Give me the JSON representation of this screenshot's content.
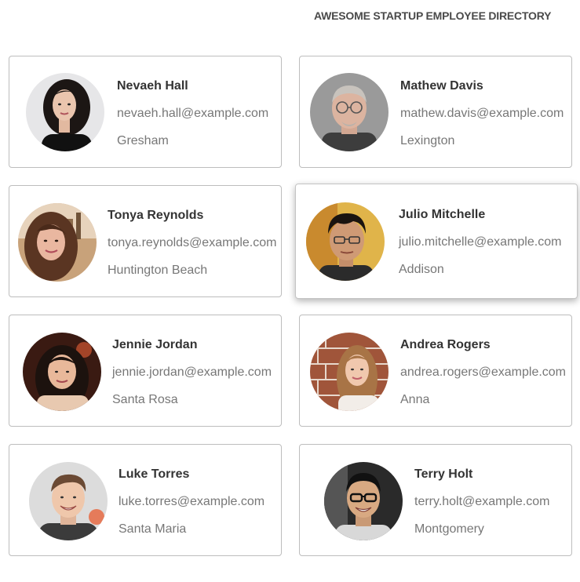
{
  "header": {
    "title": "AWESOME STARTUP EMPLOYEE DIRECTORY"
  },
  "employees": [
    {
      "name": "Nevaeh Hall",
      "email": "nevaeh.hall@example.com",
      "city": "Gresham"
    },
    {
      "name": "Mathew Davis",
      "email": "mathew.davis@example.com",
      "city": "Lexington"
    },
    {
      "name": "Tonya Reynolds",
      "email": "tonya.reynolds@example.com",
      "city": "Huntington Beach"
    },
    {
      "name": "Julio Mitchelle",
      "email": "julio.mitchelle@example.com",
      "city": "Addison"
    },
    {
      "name": "Jennie Jordan",
      "email": "jennie.jordan@example.com",
      "city": "Santa Rosa"
    },
    {
      "name": "Andrea Rogers",
      "email": "andrea.rogers@example.com",
      "city": "Anna"
    },
    {
      "name": "Luke Torres",
      "email": "luke.torres@example.com",
      "city": "Santa Maria"
    },
    {
      "name": "Terry Holt",
      "email": "terry.holt@example.com",
      "city": "Montgomery"
    }
  ],
  "colors": {
    "card_border": "#bdbdbd",
    "name_text": "#333333",
    "detail_text": "#777777",
    "title_text": "#4a4a4a"
  }
}
